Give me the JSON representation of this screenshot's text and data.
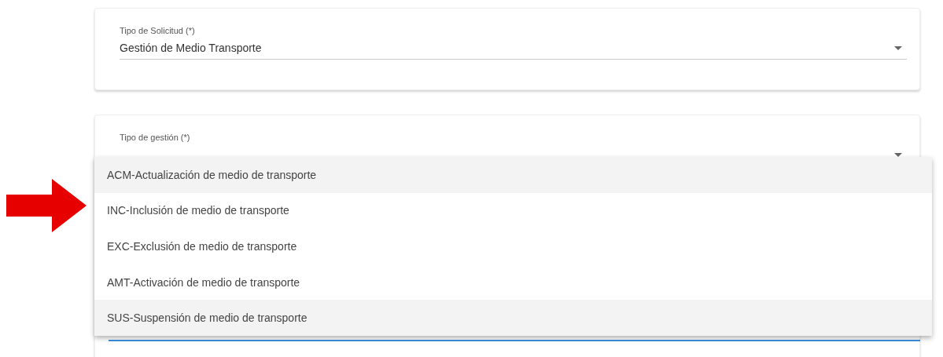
{
  "request_type": {
    "label": "Tipo de Solicitud (*)",
    "value": "Gestión de Medio Transporte"
  },
  "management_type": {
    "label": "Tipo de gestión (*)",
    "focused": true
  },
  "menu": {
    "options": [
      {
        "label": "ACM-Actualización de medio de transporte",
        "highlighted": true
      },
      {
        "label": "INC-Inclusión de medio de transporte",
        "highlighted": false
      },
      {
        "label": "EXC-Exclusión de medio de transporte",
        "highlighted": false
      },
      {
        "label": "AMT-Activación de medio de transporte",
        "highlighted": false
      },
      {
        "label": "SUS-Suspensión de medio de transporte",
        "highlighted": true
      }
    ]
  }
}
